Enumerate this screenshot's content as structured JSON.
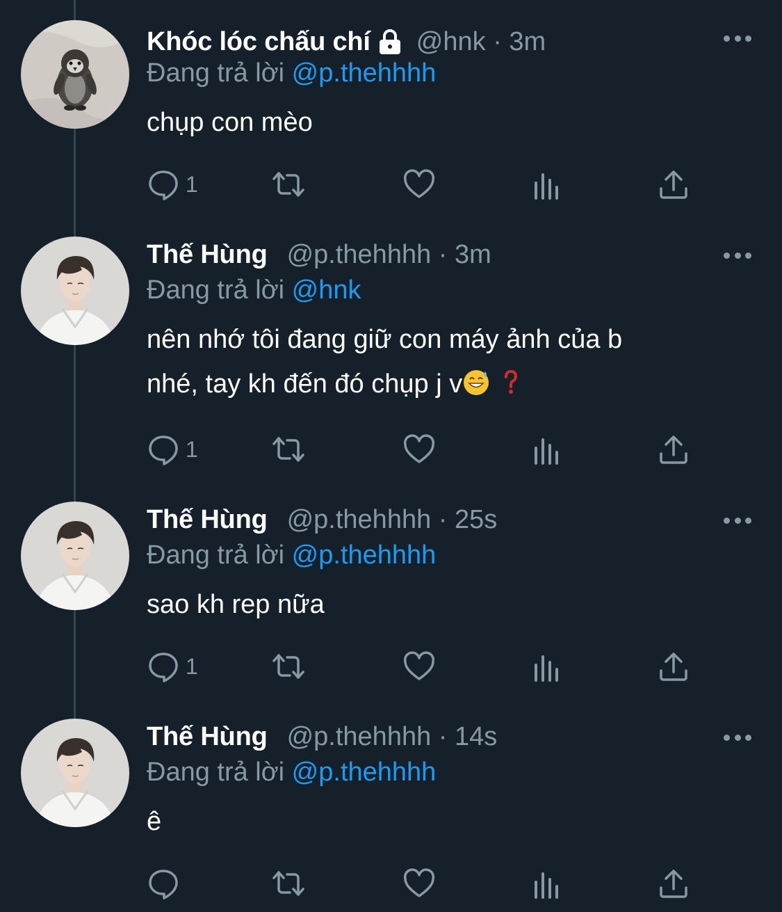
{
  "tweets": [
    {
      "name": "Khóc lóc chấu chí",
      "handle": "@hnk",
      "time": "3m",
      "separator": "·",
      "replying_prefix": "Đang trả lời",
      "replying_to": "@p.thehhhh",
      "text": "chụp con mèo",
      "text2": "",
      "reply_count": "1",
      "avatar_icon": "penguin-plush-avatar",
      "locked": true
    },
    {
      "name": "Thế Hùng",
      "handle": "@p.thehhhh",
      "time": "3m",
      "separator": "·",
      "replying_prefix": "Đang trả lời",
      "replying_to": "@hnk",
      "text": "nên nhớ tôi đang giữ con máy ảnh của b",
      "text2": "nhé, tay kh đến đó chụp j v",
      "reply_count": "1",
      "avatar_icon": "person-white-shirt-avatar",
      "locked": false
    },
    {
      "name": "Thế Hùng",
      "handle": "@p.thehhhh",
      "time": "25s",
      "separator": "·",
      "replying_prefix": "Đang trả lời",
      "replying_to": "@p.thehhhh",
      "text": "sao kh rep nữa",
      "text2": "",
      "reply_count": "1",
      "avatar_icon": "person-white-shirt-avatar",
      "locked": false
    },
    {
      "name": "Thế Hùng",
      "handle": "@p.thehhhh",
      "time": "14s",
      "separator": "·",
      "replying_prefix": "Đang trả lời",
      "replying_to": "@p.thehhhh",
      "text": "ê",
      "text2": "",
      "reply_count": "",
      "avatar_icon": "person-white-shirt-avatar",
      "locked": false
    }
  ],
  "colors": {
    "background": "#15202b",
    "secondary_text": "#8899a6",
    "mention": "#1d9bf0",
    "thread_line": "#38444d"
  }
}
